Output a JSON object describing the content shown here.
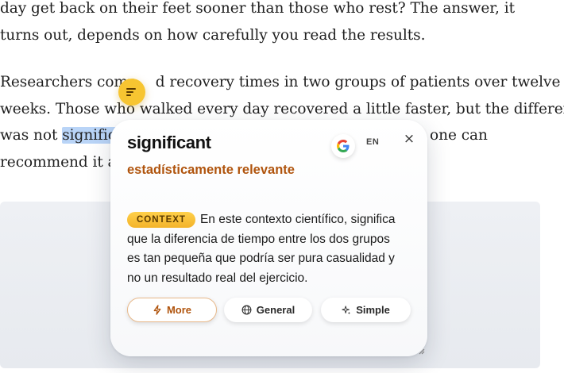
{
  "article": {
    "p1_lines": [
      "day get back on their feet sooner than those who rest? The answer, it",
      "turns out, depends on how carefully you read the results."
    ],
    "p2_line1_before": "Researchers comp",
    "p2_line1_after": "d recovery times in two groups of patients over twelve",
    "p2_line2": "weeks. Those who walked every day recovered a little faster, but the difference",
    "p2_line3_before": "was not ",
    "p2_line3_highlight": "significa",
    "p2_line3_after": "one can",
    "p2_line4": "recommend it as"
  },
  "popup": {
    "word": "significant",
    "translation": "estadísticamente relevante",
    "language": "EN",
    "close_label": "×",
    "context_badge": "CONTEXT",
    "context_lines": [
      "En este contexto científico, significa",
      "que la diferencia de tiempo entre los dos grupos",
      "es tan pequeña que podría ser pura casualidad y",
      "no un resultado real del ejercicio."
    ],
    "buttons": {
      "more": "More",
      "general": "General",
      "simple": "Simple"
    },
    "icons": {
      "google": "google-icon",
      "more": "bolt-icon",
      "general": "globe-icon",
      "simple": "sparkle-icon",
      "resize": "resize-grip-icon",
      "fab": "lines-icon"
    },
    "colors": {
      "accent": "#b0540d",
      "badge": "#f7c531",
      "highlight": "#b9d4f7"
    }
  }
}
